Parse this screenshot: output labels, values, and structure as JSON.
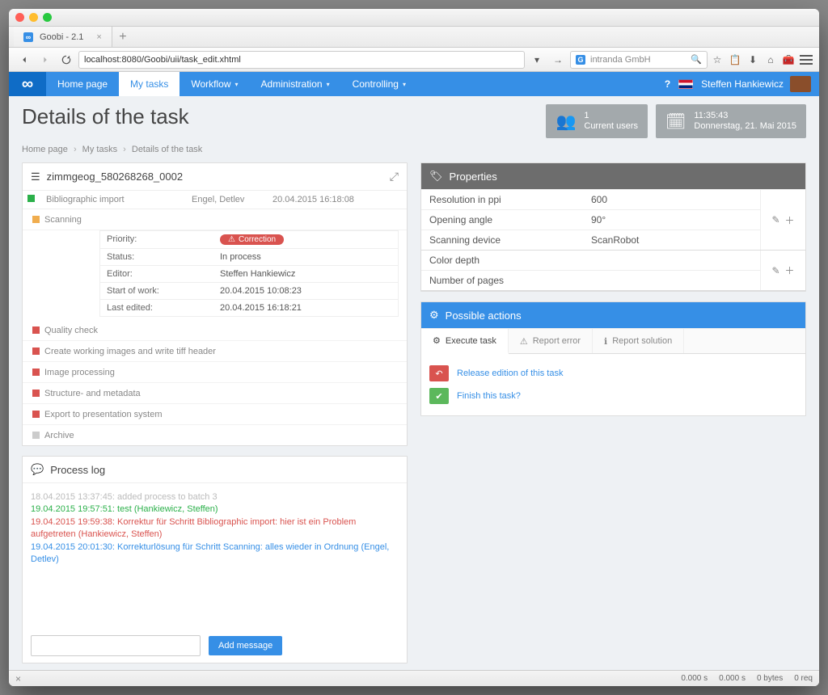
{
  "browser": {
    "tab_title": "Goobi - 2.1",
    "url": "localhost:8080/Goobi/uii/task_edit.xhtml",
    "search_placeholder": "intranda GmbH"
  },
  "nav": {
    "home": "Home page",
    "mytasks": "My tasks",
    "workflow": "Workflow",
    "admin": "Administration",
    "controlling": "Controlling",
    "username": "Steffen Hankiewicz"
  },
  "header": {
    "title": "Details of the task",
    "users_count": "1",
    "users_label": "Current users",
    "time": "11:35:43",
    "date": "Donnerstag, 21. Mai 2015"
  },
  "breadcrumb": {
    "a": "Home page",
    "b": "My tasks",
    "c": "Details of the task"
  },
  "task_panel": {
    "title": "zimmgeog_580268268_0002",
    "header_row": {
      "name": "Bibliographic import",
      "user": "Engel, Detlev",
      "date": "20.04.2015 16:18:08"
    },
    "current": "Scanning",
    "details": {
      "priority_k": "Priority:",
      "priority_v_badge": "Correction",
      "status_k": "Status:",
      "status_v": "In process",
      "editor_k": "Editor:",
      "editor_v": "Steffen Hankiewicz",
      "start_k": "Start of work:",
      "start_v": "20.04.2015 10:08:23",
      "last_k": "Last edited:",
      "last_v": "20.04.2015 16:18:21"
    },
    "steps": [
      "Quality check",
      "Create working images and write tiff header",
      "Image processing",
      "Structure- and metadata",
      "Export to presentation system",
      "Archive"
    ]
  },
  "properties": {
    "title": "Properties",
    "groups": [
      {
        "rows": [
          {
            "k": "Resolution in ppi",
            "v": "600"
          },
          {
            "k": "Opening angle",
            "v": "90°"
          },
          {
            "k": "Scanning device",
            "v": "ScanRobot"
          }
        ]
      },
      {
        "rows": [
          {
            "k": "Color depth",
            "v": ""
          },
          {
            "k": "Number of pages",
            "v": ""
          }
        ]
      }
    ]
  },
  "actions": {
    "title": "Possible actions",
    "tabs": {
      "exec": "Execute task",
      "report": "Report error",
      "solution": "Report solution"
    },
    "release": "Release edition of this task",
    "finish": "Finish this task?"
  },
  "log": {
    "title": "Process log",
    "lines": [
      {
        "cls": "log-grey",
        "t": "18.04.2015 13:37:45: added process to batch 3"
      },
      {
        "cls": "log-green",
        "t": "19.04.2015 19:57:51: test (Hankiewicz, Steffen)"
      },
      {
        "cls": "log-red",
        "t": "19.04.2015 19:59:38: Korrektur für Schritt Bibliographic import: hier ist ein Problem aufgetreten (Hankiewicz, Steffen)"
      },
      {
        "cls": "log-blue",
        "t": "19.04.2015 20:01:30: Korrekturlösung für Schritt Scanning: alles wieder in Ordnung (Engel, Detlev)"
      }
    ],
    "add_btn": "Add message"
  },
  "status": {
    "a": "0.000 s",
    "b": "0.000 s",
    "c": "0 bytes",
    "d": "0 req"
  }
}
